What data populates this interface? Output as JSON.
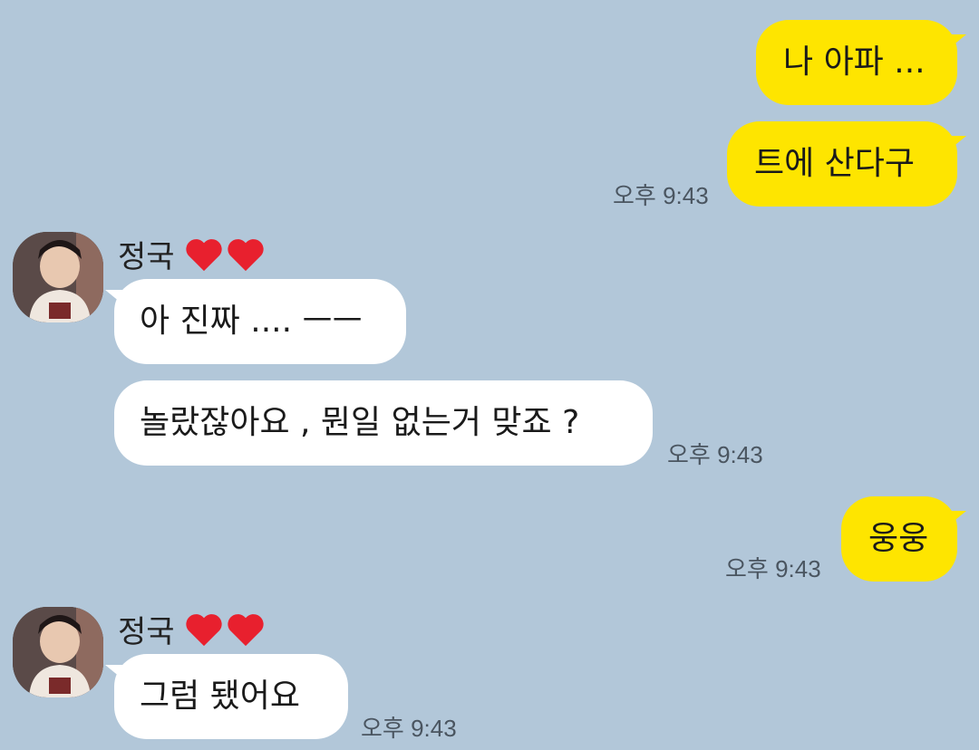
{
  "colors": {
    "background": "#b2c7d9",
    "my_bubble": "#fee500",
    "their_bubble": "#ffffff",
    "heart": "#e8202e"
  },
  "messages": [
    {
      "side": "mine",
      "text": "나 아파 ..."
    },
    {
      "side": "mine",
      "text": "트에 산다구",
      "time": "오후 9:43"
    },
    {
      "side": "theirs",
      "sender": "정국",
      "text": "아 진짜 .... ㅡㅡ"
    },
    {
      "side": "theirs",
      "text": "놀랐잖아요 , 뭔일 없는거 맞죠 ?",
      "time": "오후 9:43"
    },
    {
      "side": "mine",
      "text": "웅웅",
      "time": "오후 9:43"
    },
    {
      "side": "theirs",
      "sender": "정국",
      "text": "그럼 됐어요",
      "time": "오후 9:43"
    }
  ]
}
